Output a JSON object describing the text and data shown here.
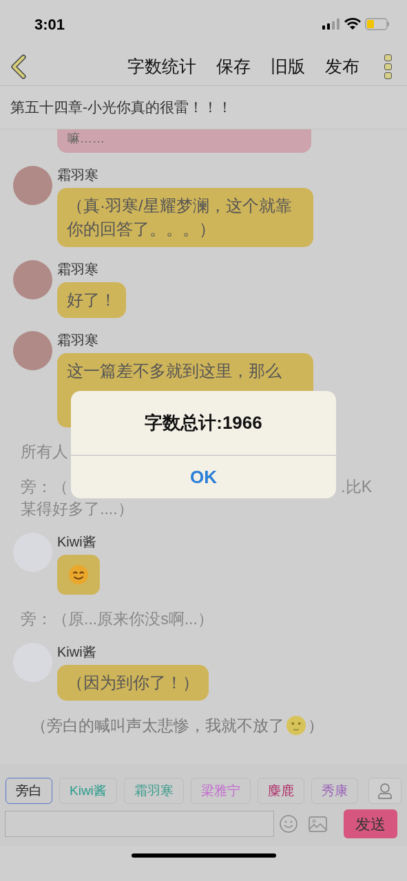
{
  "status_bar": {
    "time": "3:01"
  },
  "nav": {
    "actions": [
      "字数统计",
      "保存",
      "旧版",
      "发布"
    ]
  },
  "chapter_title": "第五十四章-小光你真的很雷！！！",
  "chat": [
    {
      "kind": "cut_bubble",
      "text": "嘛……",
      "color": "#cda4ad"
    },
    {
      "kind": "message",
      "speaker": "霜羽寒",
      "color": "#b08a86",
      "text": "（真·羽寒/星耀梦澜，这个就靠你的回答了。。。）"
    },
    {
      "kind": "message",
      "speaker": "霜羽寒",
      "color": "#b08a86",
      "text": "好了！"
    },
    {
      "kind": "message",
      "speaker": "霜羽寒",
      "color": "#b08a86",
      "text": "这一篇差不多就到这里，那么",
      "hidden_below": true
    },
    {
      "kind": "narration",
      "lines": [
        [
          "所有人"
        ]
      ]
    },
    {
      "kind": "narration",
      "lines": [
        [
          "旁：（",
          ".比K"
        ],
        [
          "某得好多了....）"
        ]
      ]
    },
    {
      "kind": "sticker",
      "speaker": "Kiwi酱",
      "color": "#d9d9e0"
    },
    {
      "kind": "narration",
      "lines": [
        [
          "旁：（原...原来你没s啊...）"
        ]
      ]
    },
    {
      "kind": "message",
      "speaker": "Kiwi酱",
      "color": "#d9d9e0",
      "text": "（因为到你了！）"
    },
    {
      "kind": "aside",
      "before": "（旁白的喊叫声太悲惨，我就不放了",
      "after": "）"
    }
  ],
  "speakers": [
    {
      "label": "旁白",
      "color": "#222222",
      "selected": true
    },
    {
      "label": "Kiwi酱",
      "color": "#2a9c8c",
      "selected": false
    },
    {
      "label": "霜羽寒",
      "color": "#3a9c8c",
      "selected": false
    },
    {
      "label": "梁雅宁",
      "color": "#c46fcf",
      "selected": false
    },
    {
      "label": "麋鹿",
      "color": "#b0306a",
      "selected": false
    },
    {
      "label": "秀康",
      "color": "#9a60b8",
      "selected": false
    }
  ],
  "composer": {
    "send": "发送"
  },
  "alert": {
    "title": "字数总计:1966",
    "button": "OK"
  }
}
